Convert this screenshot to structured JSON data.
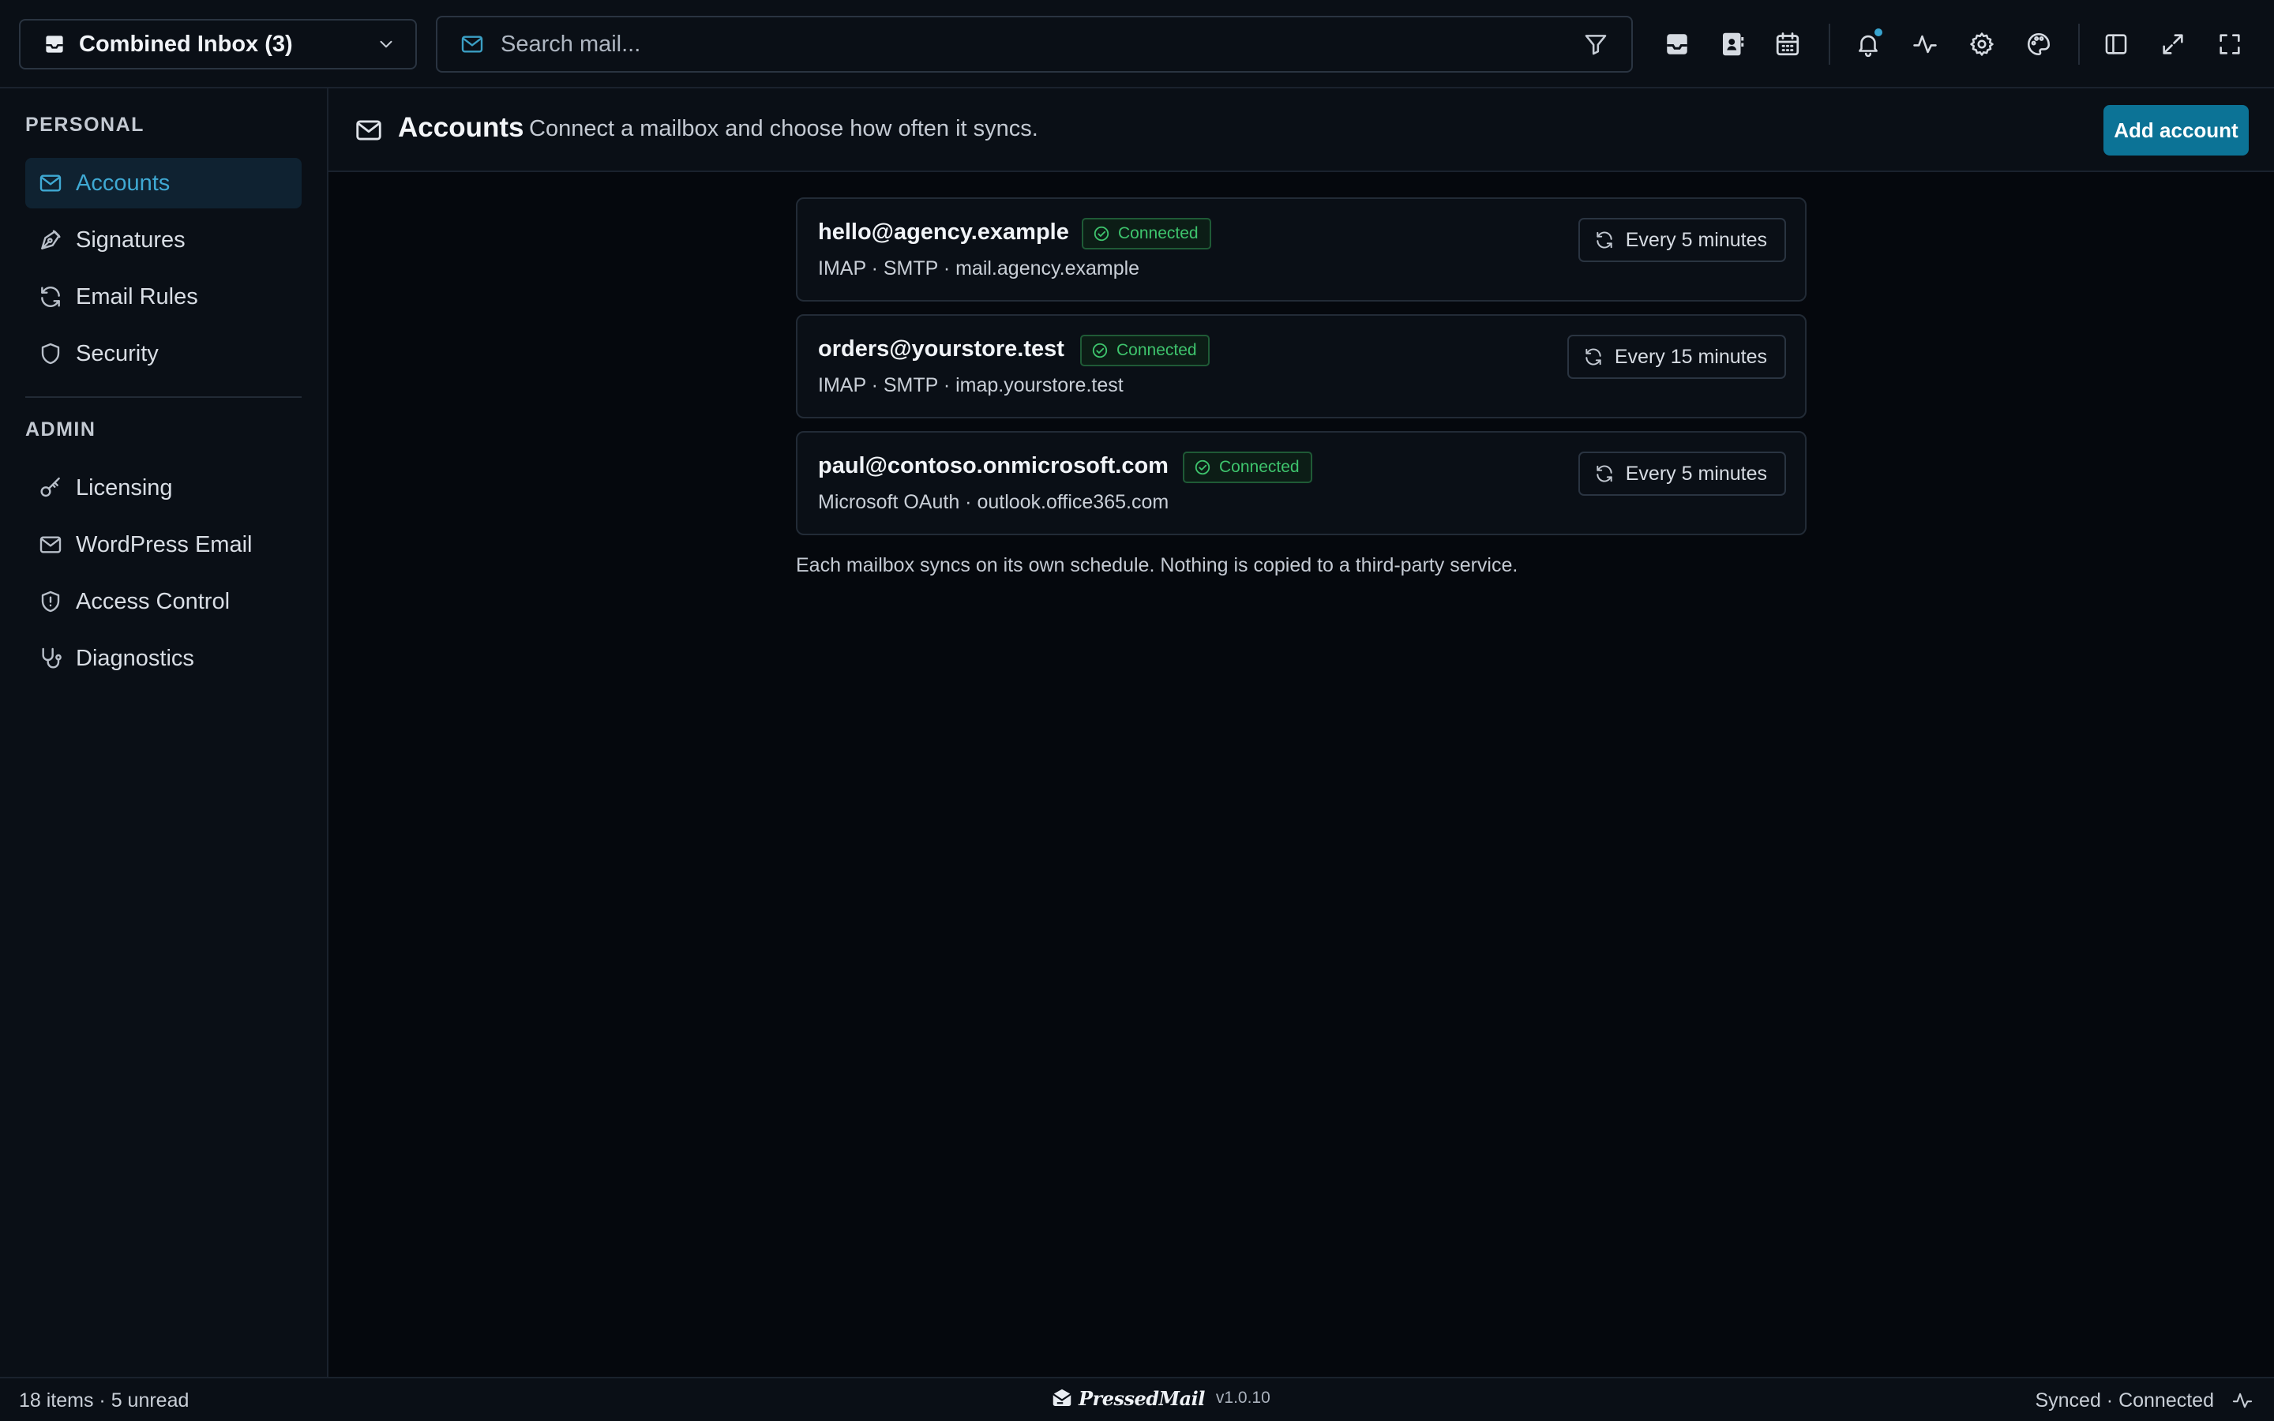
{
  "topbar": {
    "inbox_label": "Combined Inbox (3)",
    "search_placeholder": "Search mail..."
  },
  "sidebar": {
    "personal_title": "PERSONAL",
    "admin_title": "ADMIN",
    "personal_items": [
      {
        "label": "Accounts",
        "icon": "mail-icon",
        "active": true
      },
      {
        "label": "Signatures",
        "icon": "pen-icon"
      },
      {
        "label": "Email Rules",
        "icon": "refresh-icon"
      },
      {
        "label": "Security",
        "icon": "shield-icon"
      }
    ],
    "admin_items": [
      {
        "label": "Licensing",
        "icon": "key-icon"
      },
      {
        "label": "WordPress Email",
        "icon": "mail-icon"
      },
      {
        "label": "Access Control",
        "icon": "shield-alert-icon"
      },
      {
        "label": "Diagnostics",
        "icon": "stethoscope-icon"
      }
    ]
  },
  "header": {
    "title": "Accounts",
    "subtitle": "Connect a mailbox and choose how often it syncs.",
    "add_button": "Add account"
  },
  "accounts": [
    {
      "email": "hello@agency.example",
      "status": "Connected",
      "meta": "IMAP · SMTP · mail.agency.example",
      "sync": "Every 5 minutes"
    },
    {
      "email": "orders@yourstore.test",
      "status": "Connected",
      "meta": "IMAP · SMTP · imap.yourstore.test",
      "sync": "Every 15 minutes"
    },
    {
      "email": "paul@contoso.onmicrosoft.com",
      "status": "Connected",
      "meta": "Microsoft OAuth · outlook.office365.com",
      "sync": "Every 5 minutes"
    }
  ],
  "footnote": "Each mailbox syncs on its own schedule. Nothing is copied to a third-party service.",
  "status": {
    "left": "18 items · 5 unread",
    "brand": "PressedMail",
    "version": "v1.0.10",
    "right": "Synced · Connected"
  },
  "colors": {
    "accent": "#0c7396",
    "accent_text": "#3fa9d3",
    "connected": "#3ec46d",
    "background": "#05080d",
    "panel": "#0a0f16"
  }
}
